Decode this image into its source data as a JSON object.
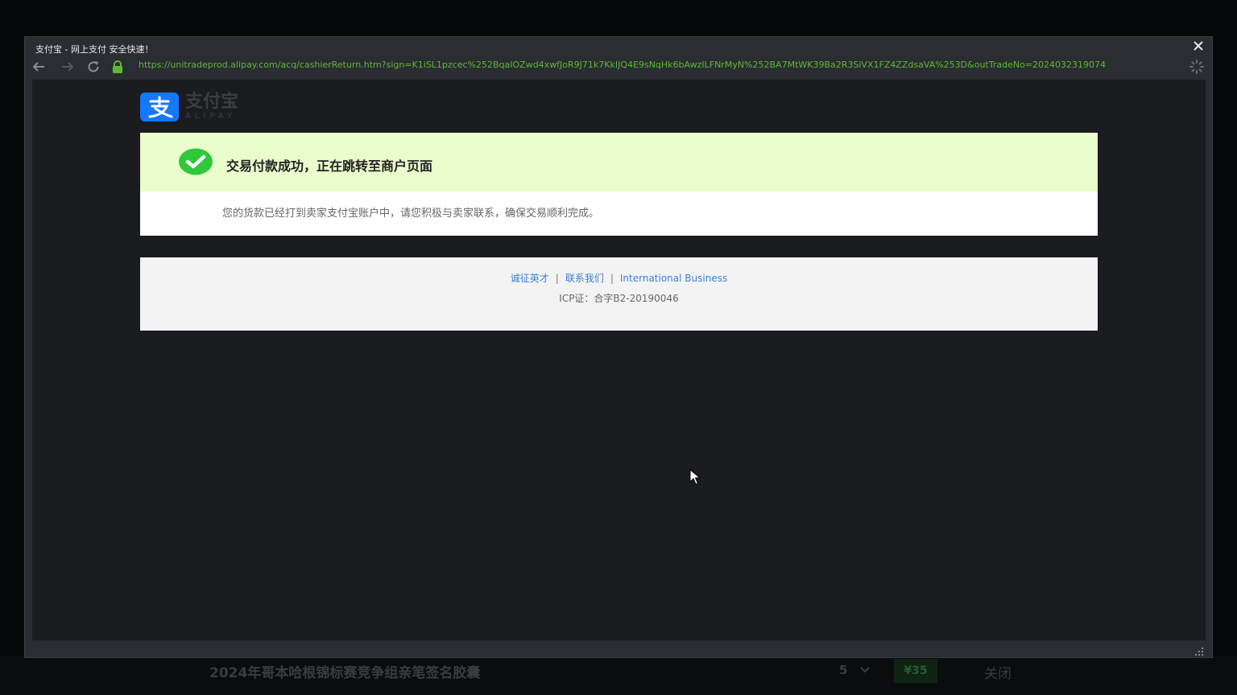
{
  "window": {
    "title": "支付宝 - 网上支付 安全快速！",
    "url": "https://unitradeprod.alipay.com/acq/cashierReturn.htm?sign=K1iSL1pzcec%252BqaIOZwd4xwfJoR9J71k7KkIJQ4E9sNqHk6bAwzILFNrMyN%252BA7MtWK39Ba2R3SiVX1FZ4ZZdsaVA%253D&outTradeNo=2024032319074",
    "icons": {
      "close": "close-icon",
      "back": "arrow-left-icon",
      "forward": "arrow-right-icon",
      "reload": "reload-icon",
      "lock": "lock-icon",
      "loading": "loading-spinner-icon"
    },
    "url_color": "#5fb836"
  },
  "logo": {
    "cn": "支付宝",
    "en": "ALIPAY",
    "mark_glyph": "支",
    "brand_color": "#1677ff"
  },
  "success": {
    "title": "交易付款成功，正在跳转至商户页面",
    "message": "您的货款已经打到卖家支付宝账户中，请您积极与卖家联系，确保交易顺利完成。",
    "header_color": "#eafdcc",
    "check_color": "#2fc83a"
  },
  "footer": {
    "links": [
      "诚征英才",
      "联系我们",
      "International Business"
    ],
    "separator": "|",
    "icp": "ICP证：合字B2-20190046",
    "link_color": "#3b7fd6"
  },
  "background_page": {
    "product_title": "2024年哥本哈根锦标赛竞争组亲笔签名胶囊",
    "quantity": "5",
    "price": "¥35",
    "close_label": "关闭"
  }
}
